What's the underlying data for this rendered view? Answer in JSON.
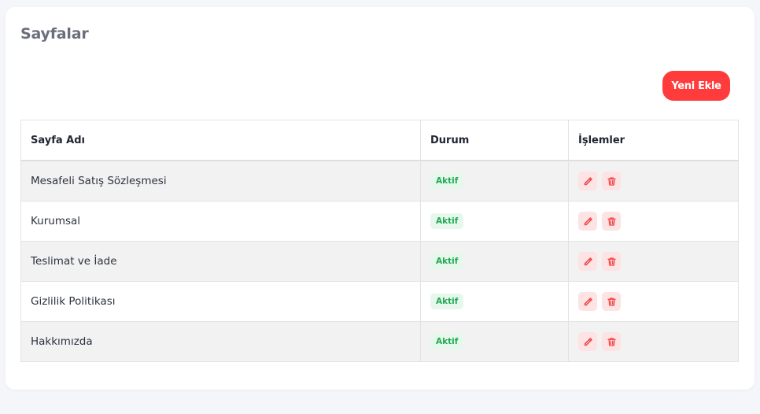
{
  "page": {
    "title": "Sayfalar",
    "add_button_label": "Yeni Ekle"
  },
  "colors": {
    "accent": "#ff3b3b",
    "status_bg": "#e6f8ec",
    "status_text": "#22a955",
    "action_bg": "#fde3e3",
    "action_icon": "#ef4444"
  },
  "table": {
    "headers": {
      "name": "Sayfa Adı",
      "status": "Durum",
      "actions": "İşlemler"
    },
    "rows": [
      {
        "name": "Mesafeli Satış Sözleşmesi",
        "status": "Aktif",
        "edit_icon": "pencil-icon",
        "delete_icon": "trash-icon"
      },
      {
        "name": "Kurumsal",
        "status": "Aktif",
        "edit_icon": "pencil-icon",
        "delete_icon": "trash-icon"
      },
      {
        "name": "Teslimat ve İade",
        "status": "Aktif",
        "edit_icon": "pencil-icon",
        "delete_icon": "trash-icon"
      },
      {
        "name": "Gizlilik Politikası",
        "status": "Aktif",
        "edit_icon": "pencil-icon",
        "delete_icon": "trash-icon"
      },
      {
        "name": "Hakkımızda",
        "status": "Aktif",
        "edit_icon": "pencil-icon",
        "delete_icon": "trash-icon"
      }
    ]
  }
}
